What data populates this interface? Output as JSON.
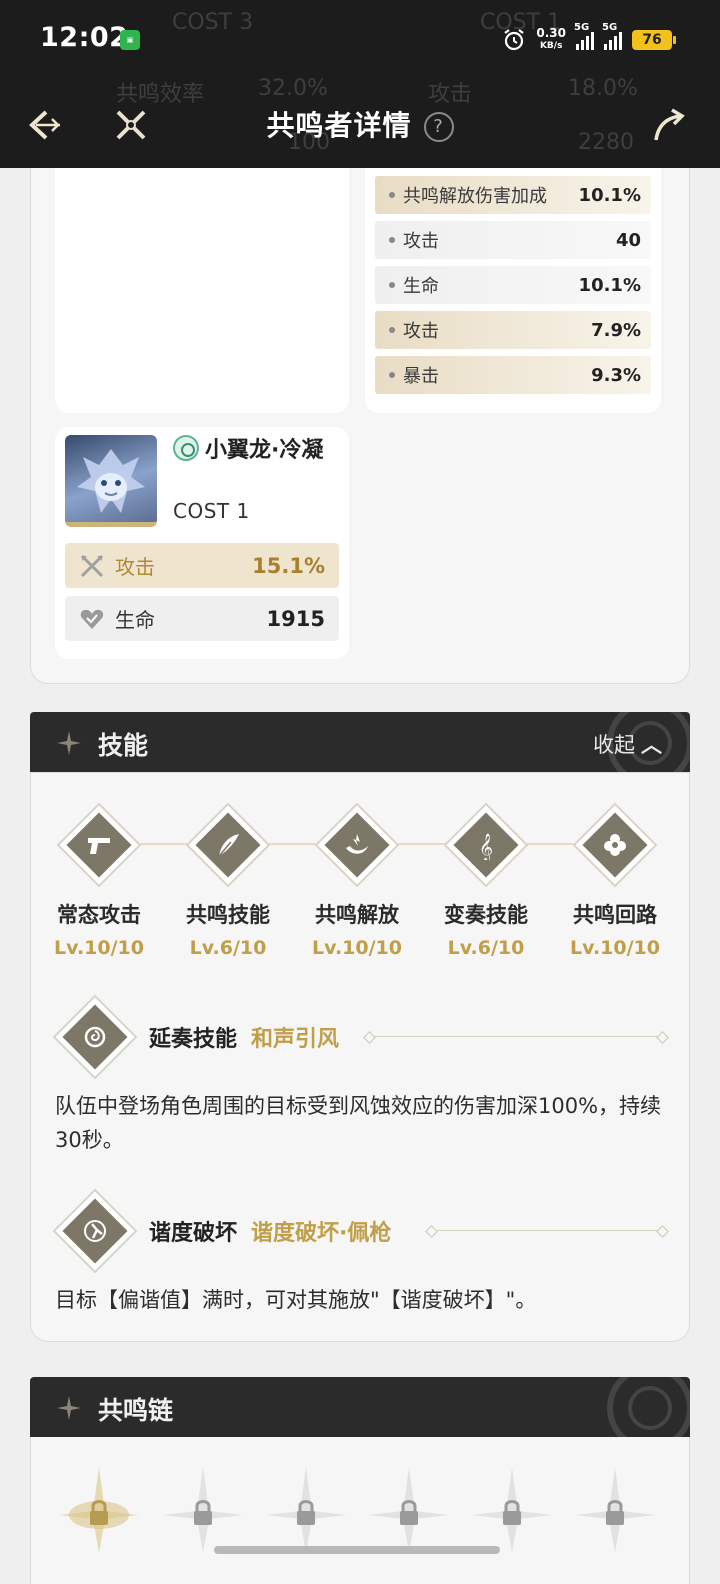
{
  "status": {
    "time": "12:02",
    "speed_value": "0.30",
    "speed_unit": "KB/s",
    "net1": "5G",
    "net2": "5G",
    "battery": "76"
  },
  "header": {
    "title": "共鸣者详情",
    "help": "?",
    "ghost_left_cost": "COST 3",
    "ghost_right_cost": "COST 1",
    "ghost_stat1": "共鸣效率",
    "ghost_val1": "32.0%",
    "ghost_stat2": "攻击",
    "ghost_val2": "18.0%",
    "ghost_val3": "100",
    "ghost_val4": "2280"
  },
  "echo_right_substats": [
    {
      "name": "共鸣解放伤害加成",
      "value": "10.1%",
      "highlight": true
    },
    {
      "name": "攻击",
      "value": "40",
      "highlight": false
    },
    {
      "name": "生命",
      "value": "10.1%",
      "highlight": false
    },
    {
      "name": "攻击",
      "value": "7.9%",
      "highlight": true
    },
    {
      "name": "暴击",
      "value": "9.3%",
      "highlight": true
    }
  ],
  "echo_card": {
    "name": "小翼龙·冷凝",
    "cost": "COST 1",
    "main_stat_name": "攻击",
    "main_stat_value": "15.1%",
    "sub_stat_name": "生命",
    "sub_stat_value": "1915"
  },
  "skills_section": {
    "title": "技能",
    "collapse_label": "收起",
    "skills": [
      {
        "name": "常态攻击",
        "level": "Lv.10/10"
      },
      {
        "name": "共鸣技能",
        "level": "Lv.6/10"
      },
      {
        "name": "共鸣解放",
        "level": "Lv.10/10"
      },
      {
        "name": "变奏技能",
        "level": "Lv.6/10"
      },
      {
        "name": "共鸣回路",
        "level": "Lv.10/10"
      }
    ],
    "outro": {
      "type": "延奏技能",
      "name": "和声引风",
      "desc": "队伍中登场角色周围的目标受到风蚀效应的伤害加深100%，持续30秒。"
    },
    "break": {
      "type": "谐度破坏",
      "name": "谐度破坏·佩枪",
      "desc": "目标【偏谐值】满时，可对其施放\"【谐度破坏】\"。"
    }
  },
  "chain_section": {
    "title": "共鸣链"
  },
  "colors": {
    "accent_gold": "#c19e48",
    "header_bg": "#1c1c1c",
    "section_bg": "#2b2b2b"
  }
}
